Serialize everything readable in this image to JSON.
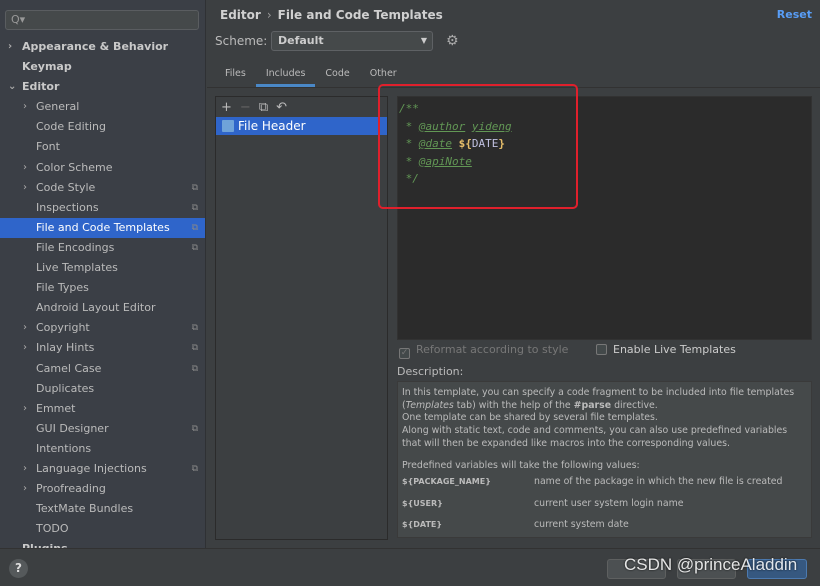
{
  "sidebar": {
    "search_placeholder": "Q▾",
    "items": [
      {
        "label": "Appearance & Behavior",
        "level": 0,
        "arrow": "›"
      },
      {
        "label": "Keymap",
        "level": 0,
        "arrow": ""
      },
      {
        "label": "Editor",
        "level": 0,
        "arrow": "⌄"
      },
      {
        "label": "General",
        "level": 1,
        "arrow": "›"
      },
      {
        "label": "Code Editing",
        "level": 1,
        "arrow": ""
      },
      {
        "label": "Font",
        "level": 1,
        "arrow": ""
      },
      {
        "label": "Color Scheme",
        "level": 1,
        "arrow": "›"
      },
      {
        "label": "Code Style",
        "level": 1,
        "arrow": "›",
        "copy": true
      },
      {
        "label": "Inspections",
        "level": 1,
        "arrow": "",
        "copy": true
      },
      {
        "label": "File and Code Templates",
        "level": 1,
        "arrow": "",
        "copy": true,
        "selected": true
      },
      {
        "label": "File Encodings",
        "level": 1,
        "arrow": "",
        "copy": true
      },
      {
        "label": "Live Templates",
        "level": 1,
        "arrow": ""
      },
      {
        "label": "File Types",
        "level": 1,
        "arrow": ""
      },
      {
        "label": "Android Layout Editor",
        "level": 1,
        "arrow": ""
      },
      {
        "label": "Copyright",
        "level": 1,
        "arrow": "›",
        "copy": true
      },
      {
        "label": "Inlay Hints",
        "level": 1,
        "arrow": "›",
        "copy": true
      },
      {
        "label": "Camel Case",
        "level": 1,
        "arrow": "",
        "copy": true
      },
      {
        "label": "Duplicates",
        "level": 1,
        "arrow": ""
      },
      {
        "label": "Emmet",
        "level": 1,
        "arrow": "›"
      },
      {
        "label": "GUI Designer",
        "level": 1,
        "arrow": "",
        "copy": true
      },
      {
        "label": "Intentions",
        "level": 1,
        "arrow": ""
      },
      {
        "label": "Language Injections",
        "level": 1,
        "arrow": "›",
        "copy": true
      },
      {
        "label": "Proofreading",
        "level": 1,
        "arrow": "›"
      },
      {
        "label": "TextMate Bundles",
        "level": 1,
        "arrow": ""
      },
      {
        "label": "TODO",
        "level": 1,
        "arrow": ""
      },
      {
        "label": "Plugins",
        "level": 0,
        "arrow": ""
      }
    ]
  },
  "header": {
    "crumb_parent": "Editor",
    "crumb_sep": "›",
    "crumb_current": "File and Code Templates",
    "reset": "Reset"
  },
  "scheme": {
    "label": "Scheme:",
    "value": "Default"
  },
  "tabs": [
    {
      "label": "Files"
    },
    {
      "label": "Includes",
      "active": true
    },
    {
      "label": "Code"
    },
    {
      "label": "Other"
    }
  ],
  "list": {
    "items": [
      "File Header"
    ]
  },
  "editor": {
    "line1": "/**",
    "star": " * ",
    "author_tag": "@author",
    "author_value": "yideng",
    "date_tag": "@date",
    "date_var_open": "${",
    "date_var": "DATE",
    "date_var_close": "}",
    "apinote_tag": "@apiNote",
    "end": " */"
  },
  "options": {
    "reformat": "Reformat according to style",
    "live_templates": "Enable Live Templates"
  },
  "description": {
    "label": "Description:",
    "p1a": "In this template, you can specify a code fragment to be included into file templates (",
    "p1_italic": "Templates",
    "p1b": " tab) with the help of the ",
    "p1_bold": "#parse",
    "p1c": " directive.",
    "p2": "One template can be shared by several file templates.",
    "p3": "Along with static text, code and comments, you can also use predefined variables that will then be expanded like macros into the corresponding values.",
    "p4": "Predefined variables will take the following values:",
    "vars": [
      {
        "name": "${PACKAGE_NAME}",
        "desc": "name of the package in which the new file is created"
      },
      {
        "name": "${USER}",
        "desc": "current user system login name"
      },
      {
        "name": "${DATE}",
        "desc": "current system date"
      }
    ]
  },
  "footer": {
    "help": "?"
  },
  "watermark": "CSDN @princeAladdin",
  "colors": {
    "accent": "#2f65ca",
    "highlight_box": "#e0202c",
    "comment": "#629755"
  }
}
